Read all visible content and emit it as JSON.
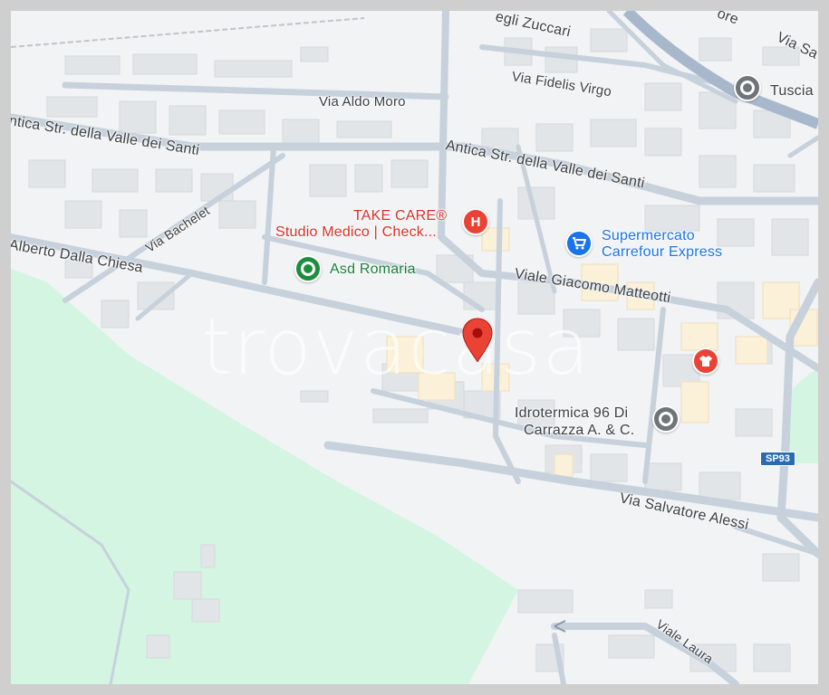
{
  "map": {
    "streets": {
      "degli_zuccari": "egli Zuccari",
      "via_sa": "Via Sa",
      "ore": "ore",
      "fidelis_virgo": "Via Fidelis Virgo",
      "aldo_moro": "Via Aldo Moro",
      "antica_left": "ntica Str. della Valle dei Santi",
      "antica_right": "Antica Str. della Valle dei Santi",
      "bachelet": "Via Bachelet",
      "dalla_chiesa": "Alberto Dalla Chiesa",
      "matteotti": "Viale Giacomo Matteotti",
      "alessi": "Via Salvatore Alessi",
      "laura": "Viale Laura"
    },
    "pois": {
      "tuscia": {
        "label": "Tuscia",
        "icon": "place-icon"
      },
      "take_care": {
        "line1": "TAKE CARE®",
        "line2": "Studio Medico | Check...",
        "icon": "hospital-icon",
        "icon_text": "H"
      },
      "carrefour": {
        "line1": "Supermercato",
        "line2": "Carrefour Express",
        "icon": "shopping-cart-icon"
      },
      "romaria": {
        "label": "Asd Romaria",
        "icon": "place-icon"
      },
      "idrotermica": {
        "line1": "Idrotermica 96 Di",
        "line2": "Carrazza A. & C.",
        "icon": "place-icon"
      },
      "shop": {
        "icon": "clothing-store-icon"
      }
    },
    "road_shield": "SP93",
    "watermark": "trovacasa",
    "colors": {
      "background": "#f1f3f4",
      "road": "#c6d1dc",
      "park": "#d4f5e2",
      "building": "#e2e5e8",
      "highway": "#a8b8cc",
      "marker": "#ea4335",
      "hospital": "#ea4335",
      "shop": "#1a73e8",
      "green_poi": "#1e8e3e",
      "grey_poi": "#70757a"
    }
  }
}
